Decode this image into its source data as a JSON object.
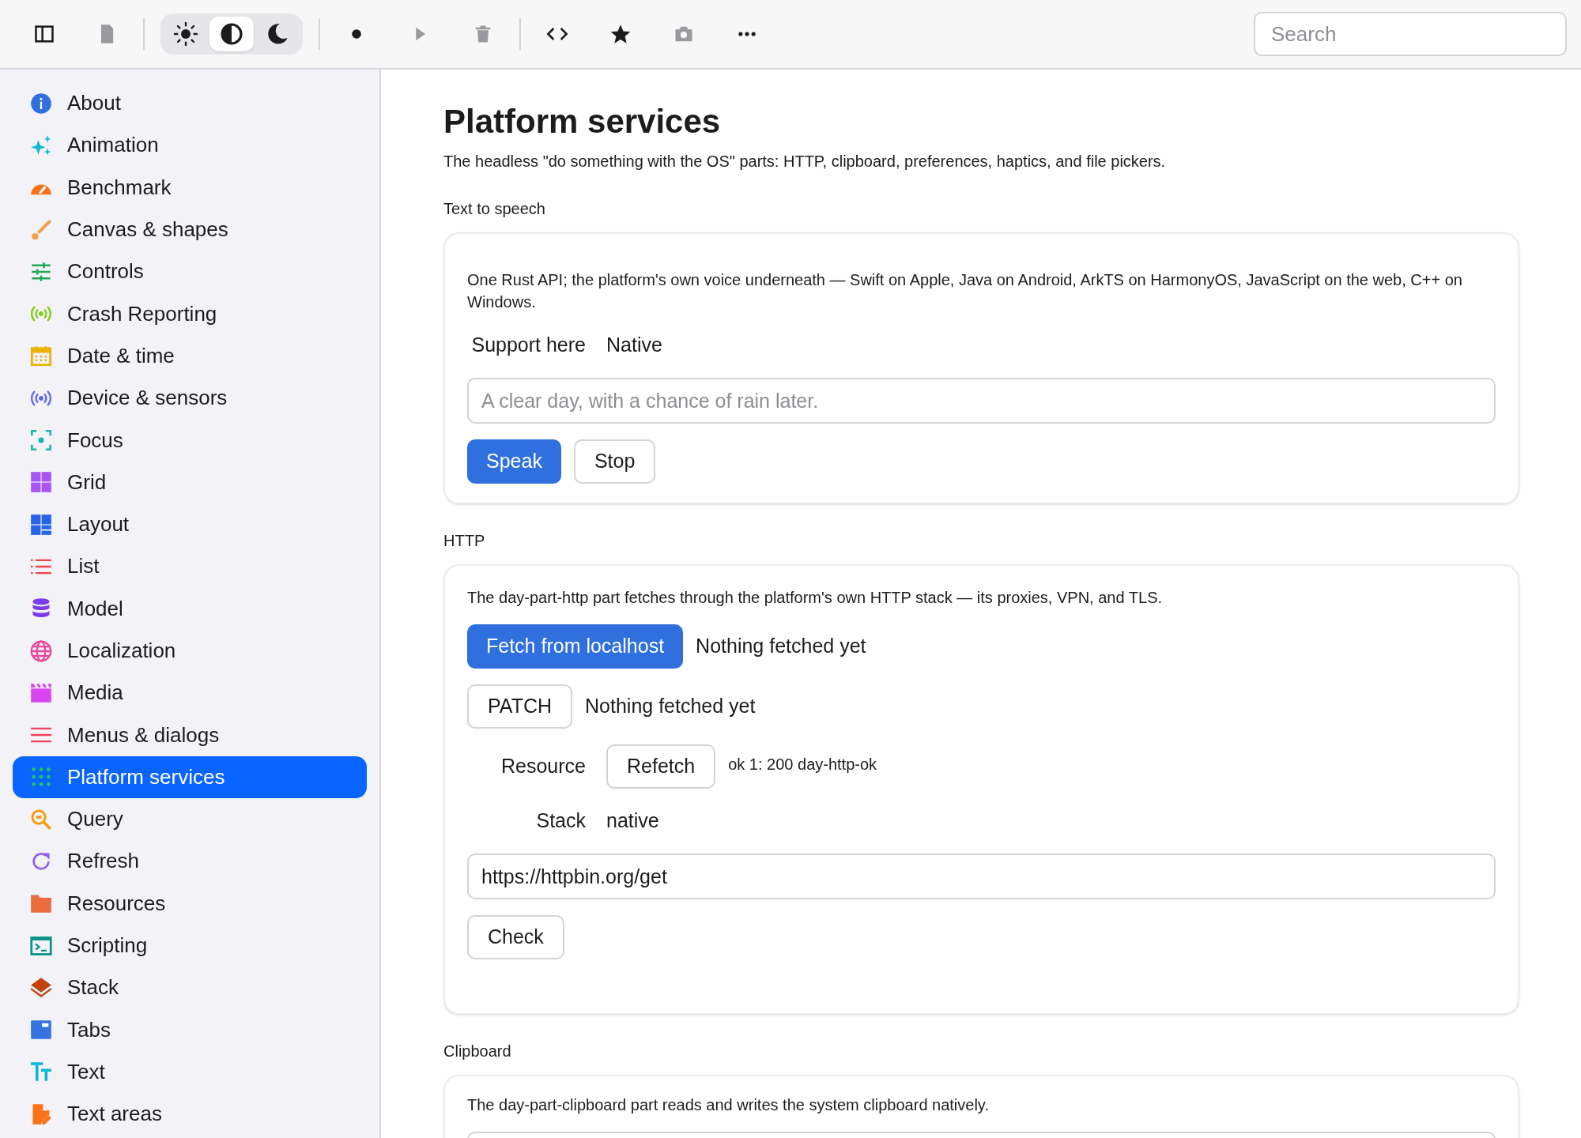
{
  "toolbar": {
    "theme_modes": [
      {
        "kind": "light",
        "selected": false
      },
      {
        "kind": "auto",
        "selected": true
      },
      {
        "kind": "dark",
        "selected": false
      }
    ],
    "search": {
      "placeholder": "Search"
    }
  },
  "sidebar": {
    "items": [
      {
        "label": "About",
        "kind": "info",
        "color": "#2f6fde",
        "selected": false
      },
      {
        "label": "Animation",
        "kind": "sparkles",
        "color": "#16b6d2",
        "selected": false
      },
      {
        "label": "Benchmark",
        "kind": "gauge",
        "color": "#f97316",
        "selected": false
      },
      {
        "label": "Canvas & shapes",
        "kind": "brush",
        "color": "#f0a04b",
        "selected": false
      },
      {
        "label": "Controls",
        "kind": "sliders",
        "color": "#22a855",
        "selected": false
      },
      {
        "label": "Crash Reporting",
        "kind": "broadcast",
        "color": "#84cc16",
        "selected": false
      },
      {
        "label": "Date & time",
        "kind": "calendar",
        "color": "#eab308",
        "selected": false
      },
      {
        "label": "Device & sensors",
        "kind": "broadcast",
        "color": "#6366f1",
        "selected": false
      },
      {
        "label": "Focus",
        "kind": "focus",
        "color": "#14b8a6",
        "selected": false
      },
      {
        "label": "Grid",
        "kind": "grid",
        "color": "#a855f7",
        "selected": false
      },
      {
        "label": "Layout",
        "kind": "layout",
        "color": "#2563eb",
        "selected": false
      },
      {
        "label": "List",
        "kind": "list",
        "color": "#ef4444",
        "selected": false
      },
      {
        "label": "Model",
        "kind": "database",
        "color": "#7c3aed",
        "selected": false
      },
      {
        "label": "Localization",
        "kind": "globe",
        "color": "#ec4899",
        "selected": false
      },
      {
        "label": "Media",
        "kind": "clapper",
        "color": "#d946ef",
        "selected": false
      },
      {
        "label": "Menus & dialogs",
        "kind": "menu",
        "color": "#f43f5e",
        "selected": false
      },
      {
        "label": "Platform services",
        "kind": "dots",
        "color": "#22c55e",
        "selected": true
      },
      {
        "label": "Query",
        "kind": "search",
        "color": "#f59e0b",
        "selected": false
      },
      {
        "label": "Refresh",
        "kind": "refresh",
        "color": "#8b5cf6",
        "selected": false
      },
      {
        "label": "Resources",
        "kind": "folder",
        "color": "#ea6c3f",
        "selected": false
      },
      {
        "label": "Scripting",
        "kind": "terminal",
        "color": "#0d9488",
        "selected": false
      },
      {
        "label": "Stack",
        "kind": "layers",
        "color": "#c2410c",
        "selected": false
      },
      {
        "label": "Tabs",
        "kind": "tabs",
        "color": "#3574e0",
        "selected": false
      },
      {
        "label": "Text",
        "kind": "text",
        "color": "#06b6d4",
        "selected": false
      },
      {
        "label": "Text areas",
        "kind": "file-edit",
        "color": "#f97316",
        "selected": false
      }
    ]
  },
  "page": {
    "title": "Platform services",
    "subtitle": "The headless \"do something with the OS\" parts: HTTP, clipboard, preferences, haptics, and file pickers.",
    "sections": [
      {
        "heading": "Text to speech",
        "blocks": [
          {
            "kind": "paragraph",
            "text": "One Rust API; the platform's own voice underneath — Swift on Apple, Java on Android, ArkTS on HarmonyOS, JavaScript on the web, C++ on Windows."
          },
          {
            "kind": "pair",
            "label": "Support here",
            "value": "Native"
          },
          {
            "kind": "field",
            "placeholder": "A clear day, with a chance of rain later."
          },
          {
            "kind": "buttons",
            "buttons": [
              {
                "label": "Speak",
                "primary": true
              },
              {
                "label": "Stop",
                "primary": false
              }
            ]
          }
        ]
      },
      {
        "heading": "HTTP",
        "blocks": [
          {
            "kind": "paragraph",
            "text": "The day-part-http part fetches through the platform's own HTTP stack — its proxies, VPN, and TLS."
          },
          {
            "kind": "button_status",
            "button": {
              "label": "Fetch from localhost",
              "primary": true
            },
            "status": "Nothing fetched yet"
          },
          {
            "kind": "button_status",
            "button": {
              "label": "PATCH",
              "primary": false
            },
            "status": "Nothing fetched yet"
          },
          {
            "kind": "pair_button",
            "label": "Resource",
            "button": {
              "label": "Refetch",
              "primary": false
            },
            "status": "ok 1: 200 day-http-ok"
          },
          {
            "kind": "pair",
            "label": "Stack",
            "value": "native"
          },
          {
            "kind": "field",
            "value": "https://httpbin.org/get"
          },
          {
            "kind": "buttons",
            "buttons": [
              {
                "label": "Check",
                "primary": false
              }
            ]
          }
        ]
      },
      {
        "heading": "Clipboard",
        "blocks": [
          {
            "kind": "paragraph",
            "text": "The day-part-clipboard part reads and writes the system clipboard natively."
          },
          {
            "kind": "field"
          }
        ]
      }
    ]
  }
}
